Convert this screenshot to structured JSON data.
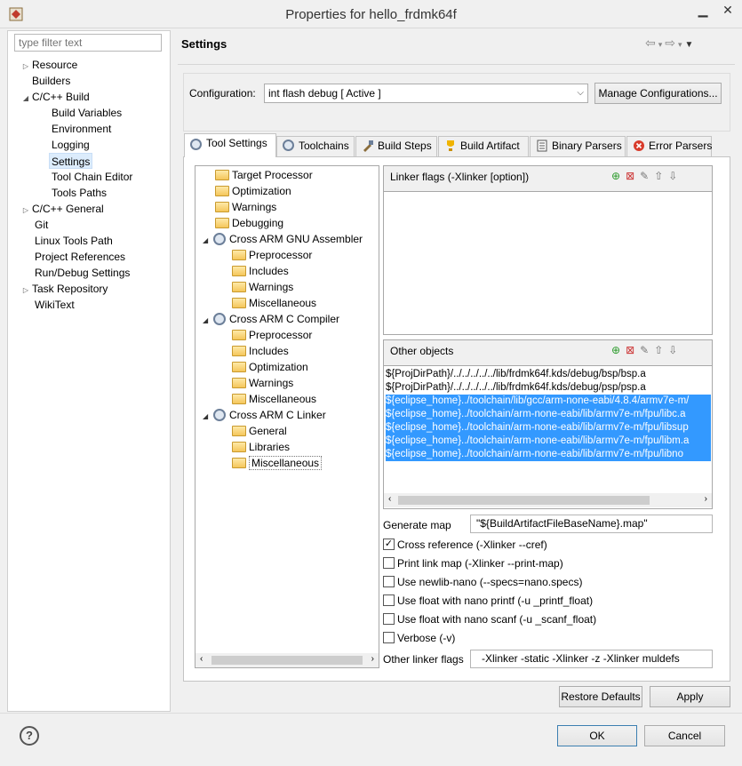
{
  "window": {
    "title": "Properties for hello_frdmk64f"
  },
  "filter": {
    "placeholder": "type filter text"
  },
  "nav": {
    "items": [
      {
        "label": "Resource",
        "twisty": "▷"
      },
      {
        "label": "Builders",
        "twisty": ""
      },
      {
        "label": "C/C++ Build",
        "twisty": "◢"
      },
      {
        "label": "Build Variables",
        "twisty": ""
      },
      {
        "label": "Environment",
        "twisty": ""
      },
      {
        "label": "Logging",
        "twisty": ""
      },
      {
        "label": "Settings",
        "twisty": ""
      },
      {
        "label": "Tool Chain Editor",
        "twisty": ""
      },
      {
        "label": "Tools Paths",
        "twisty": ""
      },
      {
        "label": "C/C++ General",
        "twisty": "▷"
      },
      {
        "label": "Git",
        "twisty": ""
      },
      {
        "label": "Linux Tools Path",
        "twisty": ""
      },
      {
        "label": "Project References",
        "twisty": ""
      },
      {
        "label": "Run/Debug Settings",
        "twisty": ""
      },
      {
        "label": "Task Repository",
        "twisty": "▷"
      },
      {
        "label": "WikiText",
        "twisty": ""
      }
    ]
  },
  "page": {
    "title": "Settings"
  },
  "config": {
    "label": "Configuration:",
    "value": "int flash debug  [ Active ]",
    "manage_label": "Manage Configurations..."
  },
  "tabs": [
    {
      "label": "Tool Settings"
    },
    {
      "label": "Toolchains"
    },
    {
      "label": "Build Steps"
    },
    {
      "label": "Build Artifact"
    },
    {
      "label": "Binary Parsers"
    },
    {
      "label": "Error Parsers"
    }
  ],
  "tool_tree": [
    {
      "label": "Target Processor"
    },
    {
      "label": "Optimization"
    },
    {
      "label": "Warnings"
    },
    {
      "label": "Debugging"
    },
    {
      "label": "Cross ARM GNU Assembler"
    },
    {
      "label": "Preprocessor"
    },
    {
      "label": "Includes"
    },
    {
      "label": "Warnings"
    },
    {
      "label": "Miscellaneous"
    },
    {
      "label": "Cross ARM C Compiler"
    },
    {
      "label": "Preprocessor"
    },
    {
      "label": "Includes"
    },
    {
      "label": "Optimization"
    },
    {
      "label": "Warnings"
    },
    {
      "label": "Miscellaneous"
    },
    {
      "label": "Cross ARM C Linker"
    },
    {
      "label": "General"
    },
    {
      "label": "Libraries"
    },
    {
      "label": "Miscellaneous"
    }
  ],
  "linker_flags": {
    "title": "Linker flags (-Xlinker [option])"
  },
  "other_objects": {
    "title": "Other objects",
    "lines": [
      "${ProjDirPath}/../../../../../lib/frdmk64f.kds/debug/bsp/bsp.a",
      "${ProjDirPath}/../../../../../lib/frdmk64f.kds/debug/psp/psp.a",
      "${eclipse_home}../toolchain/lib/gcc/arm-none-eabi/4.8.4/armv7e-m/",
      "${eclipse_home}../toolchain/arm-none-eabi/lib/armv7e-m/fpu/libc.a",
      "${eclipse_home}../toolchain/arm-none-eabi/lib/armv7e-m/fpu/libsup",
      "${eclipse_home}../toolchain/arm-none-eabi/lib/armv7e-m/fpu/libm.a",
      "${eclipse_home}../toolchain/arm-none-eabi/lib/armv7e-m/fpu/libno"
    ]
  },
  "generate_map": {
    "label": "Generate map",
    "value": "\"${BuildArtifactFileBaseName}.map\""
  },
  "checkboxes": [
    {
      "label": "Cross reference (-Xlinker --cref)",
      "mark": "✓"
    },
    {
      "label": "Print link map (-Xlinker --print-map)",
      "mark": ""
    },
    {
      "label": "Use newlib-nano (--specs=nano.specs)",
      "mark": ""
    },
    {
      "label": "Use float with nano printf (-u _printf_float)",
      "mark": ""
    },
    {
      "label": "Use float with nano scanf (-u _scanf_float)",
      "mark": ""
    },
    {
      "label": "Verbose (-v)",
      "mark": ""
    }
  ],
  "other_flags": {
    "label": "Other linker flags",
    "value": "-Xlinker -static  -Xlinker -z -Xlinker muldefs"
  },
  "buttons": {
    "restore": "Restore Defaults",
    "apply": "Apply",
    "ok": "OK",
    "cancel": "Cancel",
    "help": "?"
  }
}
